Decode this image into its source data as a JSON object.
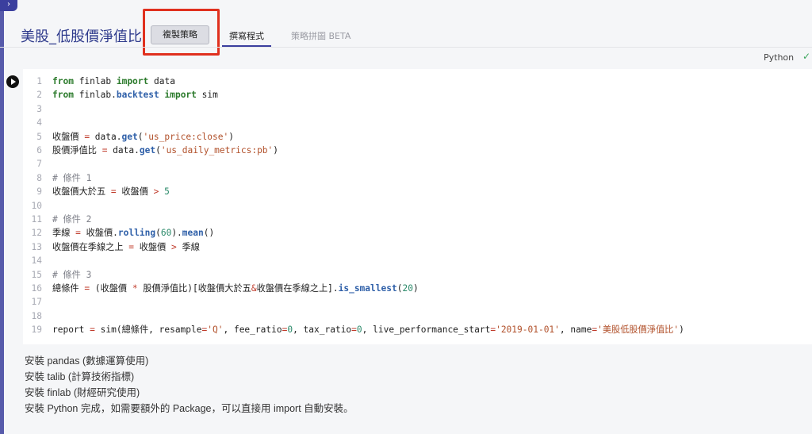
{
  "header": {
    "title": "美股_低股價淨值比",
    "copy_button": "複製策略",
    "tabs": [
      {
        "label": "撰寫程式",
        "active": true
      },
      {
        "label": "策略拼圖 BETA",
        "active": false
      }
    ],
    "corner_icon": "chevron-right-icon"
  },
  "editor": {
    "language": "Python",
    "status_icon": "check-icon",
    "run_icon": "play-icon",
    "line_numbers": [
      "1",
      "2",
      "3",
      "4",
      "5",
      "6",
      "7",
      "8",
      "9",
      "10",
      "11",
      "12",
      "13",
      "14",
      "15",
      "16",
      "17",
      "18",
      "19"
    ],
    "lines": [
      [
        {
          "t": "from",
          "c": "kw"
        },
        {
          "t": " finlab ",
          "c": "txt"
        },
        {
          "t": "import",
          "c": "kw"
        },
        {
          "t": " data",
          "c": "txt"
        }
      ],
      [
        {
          "t": "from",
          "c": "kw"
        },
        {
          "t": " finlab.",
          "c": "txt"
        },
        {
          "t": "backtest",
          "c": "fn"
        },
        {
          "t": " ",
          "c": "txt"
        },
        {
          "t": "import",
          "c": "kw"
        },
        {
          "t": " sim",
          "c": "txt"
        }
      ],
      [],
      [],
      [
        {
          "t": "收盤價 ",
          "c": "txt"
        },
        {
          "t": "=",
          "c": "op"
        },
        {
          "t": " data.",
          "c": "txt"
        },
        {
          "t": "get",
          "c": "fn"
        },
        {
          "t": "(",
          "c": "txt"
        },
        {
          "t": "'us_price:close'",
          "c": "str"
        },
        {
          "t": ")",
          "c": "txt"
        }
      ],
      [
        {
          "t": "股價淨值比 ",
          "c": "txt"
        },
        {
          "t": "=",
          "c": "op"
        },
        {
          "t": " data.",
          "c": "txt"
        },
        {
          "t": "get",
          "c": "fn"
        },
        {
          "t": "(",
          "c": "txt"
        },
        {
          "t": "'us_daily_metrics:pb'",
          "c": "str"
        },
        {
          "t": ")",
          "c": "txt"
        }
      ],
      [],
      [
        {
          "t": "# 條件 1",
          "c": "cm"
        }
      ],
      [
        {
          "t": "收盤價大於五 ",
          "c": "txt"
        },
        {
          "t": "=",
          "c": "op"
        },
        {
          "t": " 收盤價 ",
          "c": "txt"
        },
        {
          "t": ">",
          "c": "op"
        },
        {
          "t": " ",
          "c": "txt"
        },
        {
          "t": "5",
          "c": "num"
        }
      ],
      [],
      [
        {
          "t": "# 條件 2",
          "c": "cm"
        }
      ],
      [
        {
          "t": "季線 ",
          "c": "txt"
        },
        {
          "t": "=",
          "c": "op"
        },
        {
          "t": " 收盤價.",
          "c": "txt"
        },
        {
          "t": "rolling",
          "c": "fn"
        },
        {
          "t": "(",
          "c": "txt"
        },
        {
          "t": "60",
          "c": "num"
        },
        {
          "t": ").",
          "c": "txt"
        },
        {
          "t": "mean",
          "c": "fn"
        },
        {
          "t": "()",
          "c": "txt"
        }
      ],
      [
        {
          "t": "收盤價在季線之上 ",
          "c": "txt"
        },
        {
          "t": "=",
          "c": "op"
        },
        {
          "t": " 收盤價 ",
          "c": "txt"
        },
        {
          "t": ">",
          "c": "op"
        },
        {
          "t": " 季線",
          "c": "txt"
        }
      ],
      [],
      [
        {
          "t": "# 條件 3",
          "c": "cm"
        }
      ],
      [
        {
          "t": "總條件 ",
          "c": "txt"
        },
        {
          "t": "=",
          "c": "op"
        },
        {
          "t": " (收盤價 ",
          "c": "txt"
        },
        {
          "t": "*",
          "c": "op"
        },
        {
          "t": " 股價淨值比)[收盤價大於五",
          "c": "txt"
        },
        {
          "t": "&",
          "c": "op"
        },
        {
          "t": "收盤價在季線之上].",
          "c": "txt"
        },
        {
          "t": "is_smallest",
          "c": "fn"
        },
        {
          "t": "(",
          "c": "txt"
        },
        {
          "t": "20",
          "c": "num"
        },
        {
          "t": ")",
          "c": "txt"
        }
      ],
      [],
      [],
      [
        {
          "t": "report ",
          "c": "txt"
        },
        {
          "t": "=",
          "c": "op"
        },
        {
          "t": " sim(總條件, resample",
          "c": "txt"
        },
        {
          "t": "=",
          "c": "op"
        },
        {
          "t": "'Q'",
          "c": "str"
        },
        {
          "t": ", fee_ratio",
          "c": "txt"
        },
        {
          "t": "=",
          "c": "op"
        },
        {
          "t": "0",
          "c": "num"
        },
        {
          "t": ", tax_ratio",
          "c": "txt"
        },
        {
          "t": "=",
          "c": "op"
        },
        {
          "t": "0",
          "c": "num"
        },
        {
          "t": ", live_performance_start",
          "c": "txt"
        },
        {
          "t": "=",
          "c": "op"
        },
        {
          "t": "'2019-01-01'",
          "c": "str"
        },
        {
          "t": ", name",
          "c": "txt"
        },
        {
          "t": "=",
          "c": "op"
        },
        {
          "t": "'美股低股價淨值比'",
          "c": "str"
        },
        {
          "t": ")",
          "c": "txt"
        }
      ]
    ]
  },
  "notes": [
    "安裝 pandas (數據運算使用)",
    "安裝 talib (計算技術指標)",
    "安裝 finlab (財經研究使用)",
    "安裝 Python 完成，如需要額外的 Package，可以直接用 import 自動安裝。"
  ],
  "colors": {
    "accent": "#3b3f9e",
    "title": "#2e3a8c",
    "highlight": "#e0301e",
    "keyword": "#2b7a2b",
    "function": "#2e5fa8",
    "string": "#b1502a",
    "number": "#2b8a6a",
    "operator": "#c03b2b"
  }
}
